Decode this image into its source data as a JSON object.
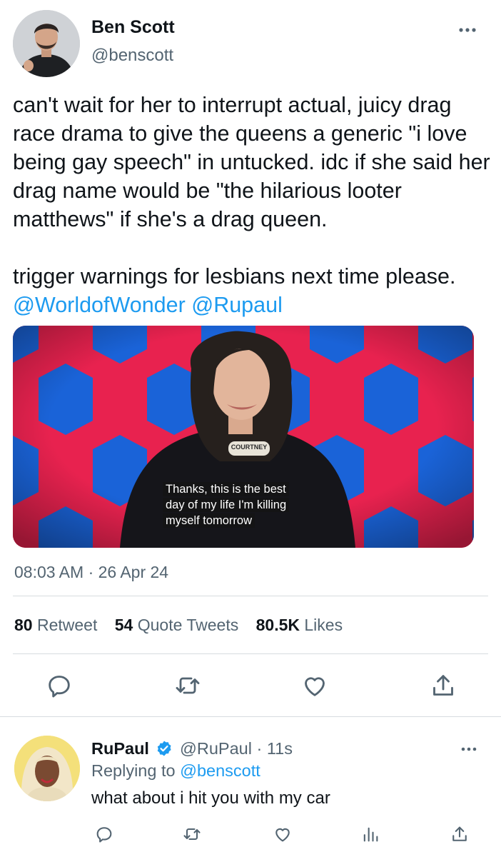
{
  "tweet": {
    "author": {
      "name": "Ben Scott",
      "handle": "@benscott",
      "more_icon": "more-horizontal-icon"
    },
    "text_paragraph_1": "can't wait for her to interrupt actual, juicy drag race drama to give the queens a generic \"i love being gay speech\" in untucked. idc if she said her drag name would be \"the hilarious looter matthews\" if she's a drag queen.",
    "text_paragraph_2": "trigger warnings for lesbians next time please.",
    "mentions": [
      "@WorldofWonder",
      "@Rupaul"
    ],
    "media": {
      "name_tag": "COURTNEY",
      "caption_lines": [
        "Thanks, this is the best",
        "day of my life I'm killing",
        "myself tomorrow"
      ],
      "colors": {
        "background": "#e8224f",
        "hexagons": "#1a63d8"
      }
    },
    "timestamp": "08:03 AM · 26 Apr 24",
    "stats": {
      "retweets_count": "80",
      "retweets_label": "Retweet",
      "quotes_count": "54",
      "quotes_label": "Quote Tweets",
      "likes_count": "80.5K",
      "likes_label": "Likes"
    },
    "actions": [
      "reply-icon",
      "retweet-icon",
      "like-icon",
      "share-icon"
    ]
  },
  "reply": {
    "name": "RuPaul",
    "verified_icon": "verified-badge-icon",
    "handle": "@RuPaul",
    "time": "· 11s",
    "replying_to_label": "Replying to",
    "replying_to_handle": "@benscott",
    "text": "what about i hit you with my car",
    "actions": [
      "reply-icon",
      "retweet-icon",
      "like-icon",
      "analytics-icon",
      "share-icon"
    ]
  },
  "colors": {
    "link": "#1d9bf0",
    "secondary_text": "#536471",
    "primary_text": "#0f1419",
    "divider": "#d7dbdf"
  }
}
